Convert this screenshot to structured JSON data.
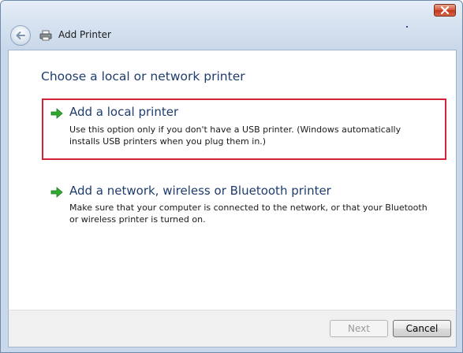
{
  "window": {
    "title": "Add Printer"
  },
  "icons": {
    "back": "back-arrow-icon",
    "printer": "printer-icon",
    "close": "close-icon",
    "option_arrow": "green-arrow-icon"
  },
  "content": {
    "heading": "Choose a local or network printer",
    "options": [
      {
        "title": "Add a local printer",
        "description_lines": [
          "Use this option only if you don't have a USB printer. (Windows automatically",
          "installs USB printers when you plug them in.)"
        ],
        "selected": true
      },
      {
        "title": "Add a network, wireless or Bluetooth printer",
        "description_lines": [
          "Make sure that your computer is connected to the network, or that your Bluetooth",
          "or wireless printer is turned on."
        ],
        "selected": false
      }
    ]
  },
  "footer": {
    "next_label": "Next",
    "next_enabled": false,
    "cancel_label": "Cancel"
  },
  "colors": {
    "heading": "#1e3d6e",
    "selection_border": "#d1233a",
    "arrow": "#2faa2f",
    "close_button": "#c2361a"
  }
}
